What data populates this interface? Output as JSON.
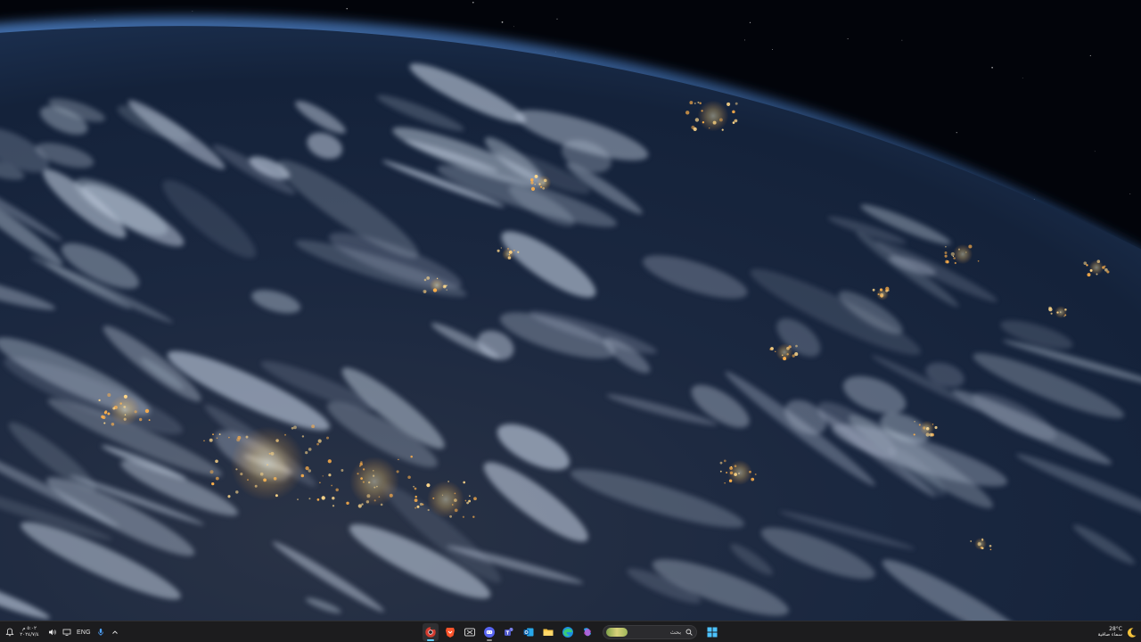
{
  "wallpaper": {
    "description_icon": "earth-night-wallpaper",
    "colors": {
      "space": "#02040a",
      "ocean": "#14213a",
      "cloud": "#b8c4d6",
      "city_light": "#ffd88a",
      "atmosphere": "#3a6aa8"
    }
  },
  "taskbar": {
    "background": "#1c1c1e",
    "tray": {
      "clock_time": "٥:٠٢ م",
      "clock_date": "٢٠٢٤/٧/٤",
      "language": "ENG",
      "icons": [
        "notification-bell-icon",
        "volume-icon",
        "display-icon",
        "language-indicator",
        "mic-icon",
        "chevron-up-icon"
      ]
    },
    "search": {
      "placeholder": "بحث",
      "icon": "search-icon"
    },
    "apps": [
      {
        "name": "chrome-dark",
        "running": true,
        "active": true
      },
      {
        "name": "brave",
        "running": false
      },
      {
        "name": "capcut",
        "running": false
      },
      {
        "name": "discord",
        "running": true
      },
      {
        "name": "teams",
        "running": false
      },
      {
        "name": "outlook",
        "running": false
      },
      {
        "name": "file-explorer",
        "running": false
      },
      {
        "name": "edge",
        "running": false
      },
      {
        "name": "copilot",
        "running": false
      }
    ],
    "start": {
      "icon": "windows-start-icon"
    },
    "weather": {
      "temperature": "28°C",
      "condition": "سماء صافية",
      "icon": "moon-icon"
    }
  }
}
